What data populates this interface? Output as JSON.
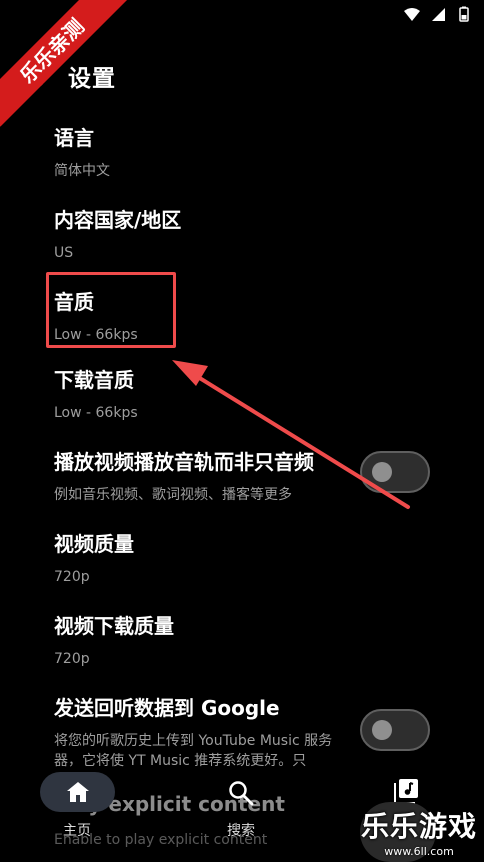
{
  "ribbon": {
    "label": "乐乐亲测"
  },
  "header": {
    "title": "设置",
    "back_icon": "back-arrow-icon"
  },
  "settings": [
    {
      "id": "language",
      "title": "语言",
      "subtitle": "简体中文"
    },
    {
      "id": "region",
      "title": "内容国家/地区",
      "subtitle": "US"
    },
    {
      "id": "audio-quality",
      "title": "音质",
      "subtitle": "Low - 66kps"
    },
    {
      "id": "download-audio-quality",
      "title": "下载音质",
      "subtitle": "Low - 66kps"
    },
    {
      "id": "video-playback",
      "title": "播放视频播放音轨而非只音频",
      "subtitle": "例如音乐视频、歌词视频、播客等更多",
      "toggle": false
    },
    {
      "id": "video-quality",
      "title": "视频质量",
      "subtitle": "720p"
    },
    {
      "id": "video-download-quality",
      "title": "视频下载质量",
      "subtitle": "720p"
    },
    {
      "id": "send-history",
      "title": "发送回听数据到 Google",
      "subtitle": "将您的听歌历史上传到 YouTube Music 服务器，它将使 YT Music 推荐系统更好。只",
      "toggle": false
    },
    {
      "id": "explicit",
      "title": "Play explicit content",
      "subtitle": "Enable to play explicit content"
    }
  ],
  "bottom_nav": {
    "home_label": "主页",
    "search_label": "搜索"
  },
  "watermark": {
    "main": "乐乐游戏",
    "sub": "www.6ll.com"
  },
  "colors": {
    "highlight": "#ef4b4b",
    "ribbon": "#d41c1c",
    "background": "#000000"
  }
}
